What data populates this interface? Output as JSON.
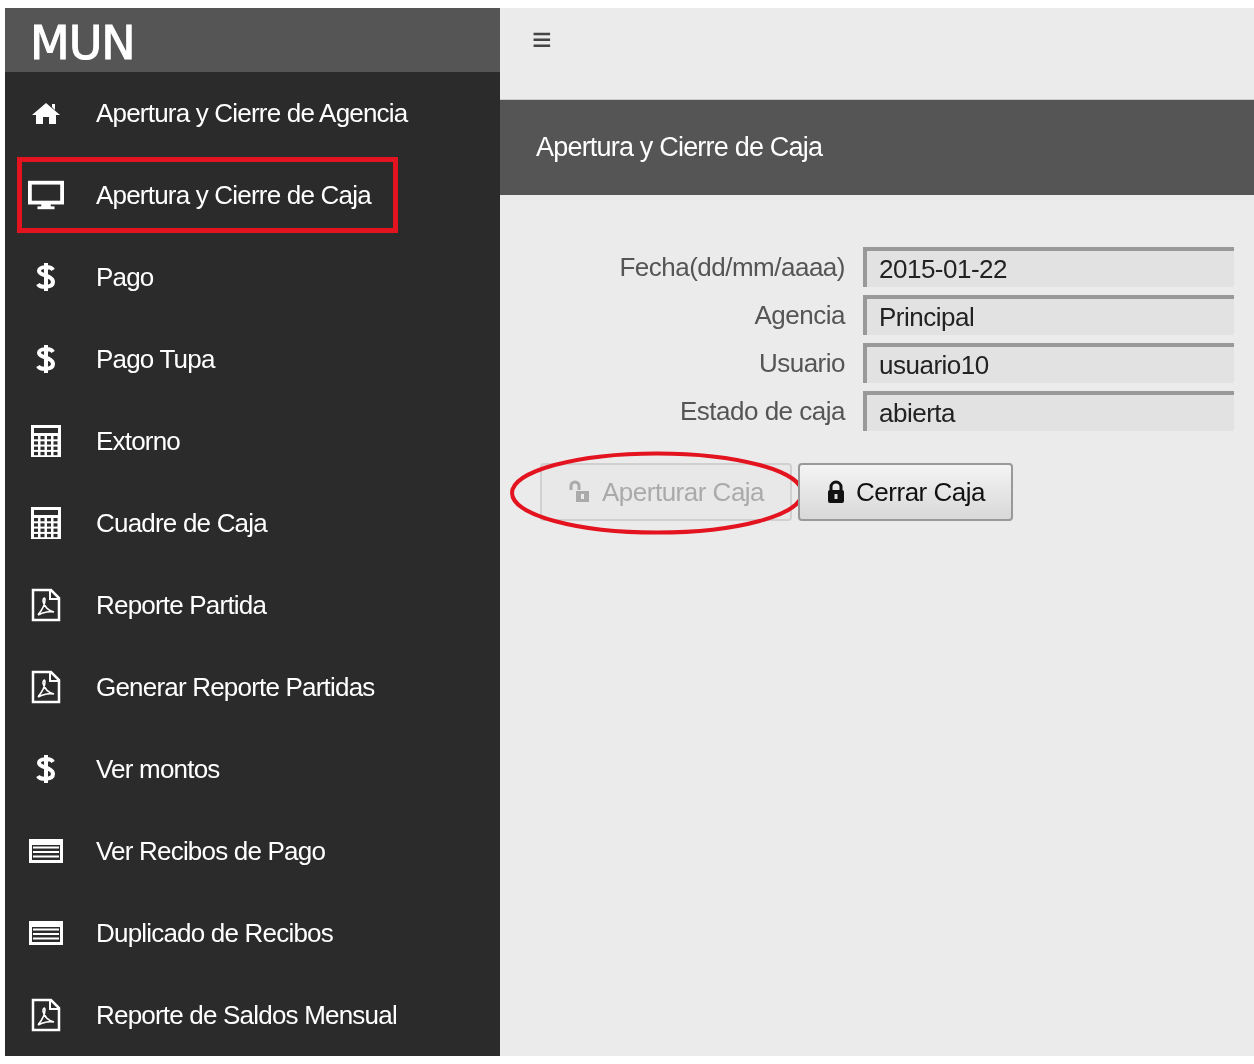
{
  "sidebar": {
    "logo": "MUN",
    "items": [
      {
        "kind": "home",
        "label": "Apertura y Cierre de Agencia",
        "highlighted": false
      },
      {
        "kind": "monitor",
        "label": "Apertura y Cierre de Caja",
        "highlighted": true
      },
      {
        "kind": "dollar",
        "label": "Pago",
        "highlighted": false
      },
      {
        "kind": "dollar",
        "label": "Pago Tupa",
        "highlighted": false
      },
      {
        "kind": "calculator",
        "label": "Extorno",
        "highlighted": false
      },
      {
        "kind": "calculator",
        "label": "Cuadre de Caja",
        "highlighted": false
      },
      {
        "kind": "pdf",
        "label": "Reporte Partida",
        "highlighted": false
      },
      {
        "kind": "pdf",
        "label": "Generar Reporte Partidas",
        "highlighted": false
      },
      {
        "kind": "dollar",
        "label": "Ver montos",
        "highlighted": false
      },
      {
        "kind": "list",
        "label": "Ver Recibos de Pago",
        "highlighted": false
      },
      {
        "kind": "list",
        "label": "Duplicado de Recibos",
        "highlighted": false
      },
      {
        "kind": "pdf",
        "label": "Reporte de Saldos Mensual",
        "highlighted": false
      }
    ]
  },
  "topbar": {
    "menu_icon": "≡"
  },
  "page_title": "Apertura y Cierre de Caja",
  "form": {
    "fields": [
      {
        "label": "Fecha(dd/mm/aaaa)",
        "value": "2015-01-22"
      },
      {
        "label": "Agencia",
        "value": "Principal"
      },
      {
        "label": "Usuario",
        "value": "usuario10"
      },
      {
        "label": "Estado de caja",
        "value": "abierta"
      }
    ],
    "buttons": [
      {
        "kind": "unlock",
        "label": "Aperturar Caja",
        "disabled": true,
        "circled": true
      },
      {
        "kind": "lock",
        "label": "Cerrar Caja",
        "disabled": false,
        "circled": false
      }
    ]
  }
}
